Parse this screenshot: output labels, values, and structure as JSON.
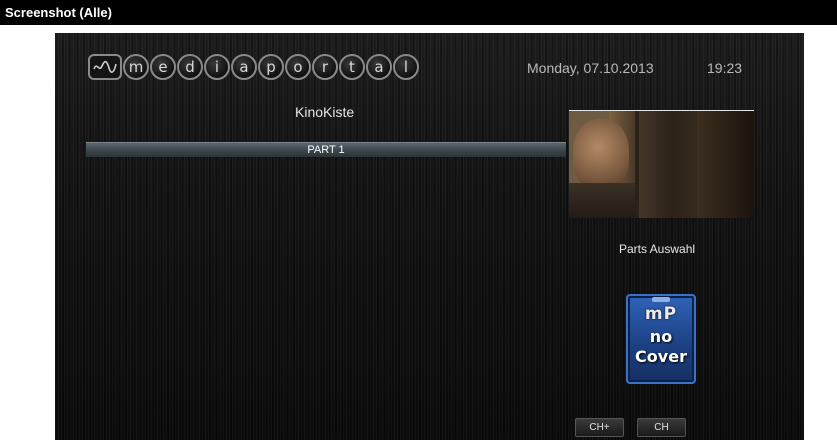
{
  "titlebar": {
    "title": "Screenshot (Alle)"
  },
  "header": {
    "logo_letters": [
      "m",
      "e",
      "d",
      "i",
      "a",
      "p",
      "o",
      "r",
      "t",
      "a",
      "l"
    ],
    "date": "Monday, 07.10.2013",
    "time": "19:23"
  },
  "main": {
    "plugin_title": "KinoKiste",
    "list": [
      {
        "label": "PART 1",
        "selected": true
      }
    ]
  },
  "side": {
    "parts_label": "Parts Auswahl",
    "cover": {
      "logo": "mP",
      "line1": "no",
      "line2": "Cover"
    }
  },
  "footer": {
    "buttons": [
      {
        "label": "CH+"
      },
      {
        "label": "CH"
      }
    ]
  },
  "colors": {
    "selection_bar": "#3c464d",
    "cover_blue": "#2f63b8",
    "text_primary": "#e6e6e6"
  }
}
